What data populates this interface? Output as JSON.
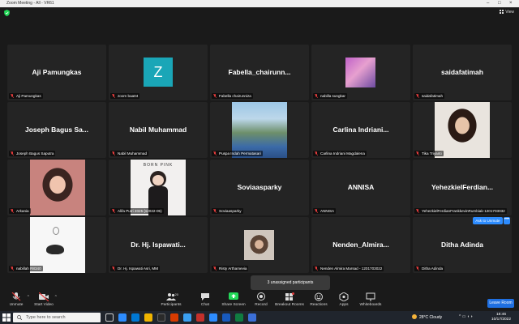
{
  "window": {
    "title": "Zoom Meeting - All - VR61"
  },
  "topbar": {
    "view_label": "View"
  },
  "tiles": [
    {
      "name": "Aji Pamungkas",
      "label": "Aji Pamungkas"
    },
    {
      "name": "",
      "label": "zoom baa04",
      "avatar_letter": "Z"
    },
    {
      "name": "Fabella_chairunn...",
      "label": "Fabella chairunniza"
    },
    {
      "name": "",
      "label": "nabilla sungkar"
    },
    {
      "name": "saidafatimah",
      "label": "saidafatimah"
    },
    {
      "name": "Joseph Bagus Sa...",
      "label": "Joseph Bagus Saputra"
    },
    {
      "name": "Nabil Muhammad",
      "label": "Nabil Muhammad"
    },
    {
      "name": "",
      "label": "Puspa Indah Permatasari"
    },
    {
      "name": "Carlina Indriani...",
      "label": "Carlina Indriani Magdalena"
    },
    {
      "name": "",
      "label": "Tika Triyanti"
    },
    {
      "name": "",
      "label": "Arkania"
    },
    {
      "name": "",
      "label": "Alifa Putri 2025 (s2022-05)",
      "poster_text": "BORN PINK"
    },
    {
      "name": "Soviaasparky",
      "label": "Soviaasparky"
    },
    {
      "name": "ANNISA",
      "label": "ANNISA"
    },
    {
      "name": "YehezkielFerdian...",
      "label": "YehezkielFerdianFrankkevinRumbiak-1201703032"
    },
    {
      "name": "",
      "label": "nabillah R8340"
    },
    {
      "name": "Dr. Hj. Ispawati...",
      "label": "Dr. Hj. Ispawati Asri, MM"
    },
    {
      "name": "",
      "label": "Risty Arthamevia"
    },
    {
      "name": "Nenden_Almira...",
      "label": "Nenden Almira Marsad - 1201703022"
    },
    {
      "name": "Ditha Adinda",
      "label": "Ditha Adinda"
    }
  ],
  "ask_unmute": "Ask to Unmute",
  "more_dots": "•••",
  "unassigned": "3 unassigned participants",
  "toolbar": {
    "unmute": "Unmute",
    "start_video": "Start Video",
    "participants": "Participants",
    "participants_count": "20",
    "chat": "Chat",
    "share_screen": "Share Screen",
    "record": "Record",
    "breakout_rooms": "Breakout Rooms",
    "reactions": "Reactions",
    "apps": "Apps",
    "whiteboards": "Whiteboards",
    "leave": "Leave Room"
  },
  "taskbar": {
    "search_placeholder": "Type here to search",
    "weather": "28°C  Cloudy",
    "time": "18:46",
    "date": "10/17/2022"
  },
  "colors": {
    "accent": "#2d8cff",
    "avatar_teal": "#1aa6b7",
    "muted_red": "#e23c3c",
    "share_green": "#23d959"
  }
}
